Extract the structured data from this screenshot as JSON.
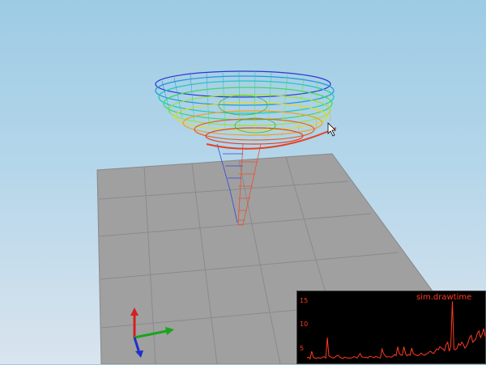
{
  "graph": {
    "label": "sim.drawtime",
    "ticks": [
      "15",
      "10",
      "5"
    ],
    "y_range": [
      3,
      18
    ],
    "samples": [
      4,
      4.2,
      3.8,
      5.5,
      4.2,
      4,
      3.9,
      4.1,
      4,
      4,
      4.2,
      4.3,
      4,
      8.5,
      4.5,
      4.3,
      4.1,
      4,
      4.2,
      4.5,
      4.6,
      4.2,
      4,
      3.9,
      4.2,
      4.1,
      4,
      4,
      4,
      4.1,
      4.3,
      4.2,
      4,
      4.5,
      5,
      4.3,
      4.2,
      4.1,
      4.2,
      4,
      4.4,
      4.3,
      4.2,
      4.1,
      4.4,
      4.2,
      4.1,
      4,
      6,
      5,
      4.5,
      4.2,
      4.3,
      4.3,
      4.2,
      4.4,
      4.8,
      4.5,
      6.5,
      5,
      4.7,
      4.6,
      6.5,
      5,
      4.5,
      4.8,
      4.6,
      6.2,
      5,
      4.8,
      4.6,
      4.5,
      4.7,
      5.1,
      4.8,
      4.6,
      4.8,
      5,
      5.3,
      5.5,
      5.2,
      5,
      5.5,
      6,
      5.8,
      6.5,
      6.2,
      6,
      5.6,
      7,
      7.5,
      5.5,
      6.5,
      16.5,
      6,
      5.8,
      6.2,
      7.2,
      6.8,
      7.5,
      7,
      6.2,
      6.6,
      7.4,
      8.5,
      9,
      7.5,
      7.8,
      8.2,
      9.5,
      10,
      8.5,
      9.2,
      10.5,
      8.8
    ]
  },
  "colors": {
    "graph_line": "#ff3b1f",
    "grid_floor": "#9a9a9a",
    "axis_x": "#d22020",
    "axis_y": "#1aa51a",
    "axis_z": "#2030c8"
  },
  "icons": {
    "cursor": "mouse-pointer-icon",
    "axes": "xyz-axes-icon"
  }
}
